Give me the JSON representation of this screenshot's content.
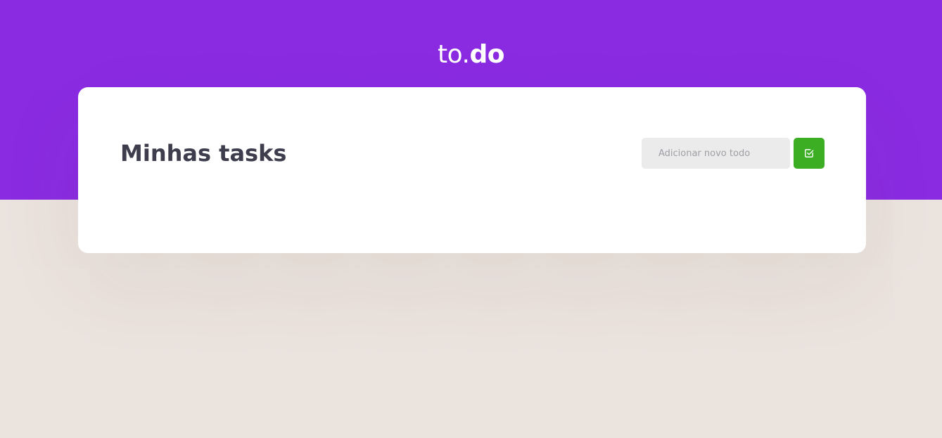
{
  "header": {
    "logo_light": "to.",
    "logo_bold": "do",
    "background_color": "#8a2be2"
  },
  "tasks": {
    "title": "Minhas tasks",
    "new_todo": {
      "placeholder": "Adicionar novo todo",
      "value": "",
      "button_icon": "check-square-icon",
      "button_color": "#3cae24"
    }
  }
}
